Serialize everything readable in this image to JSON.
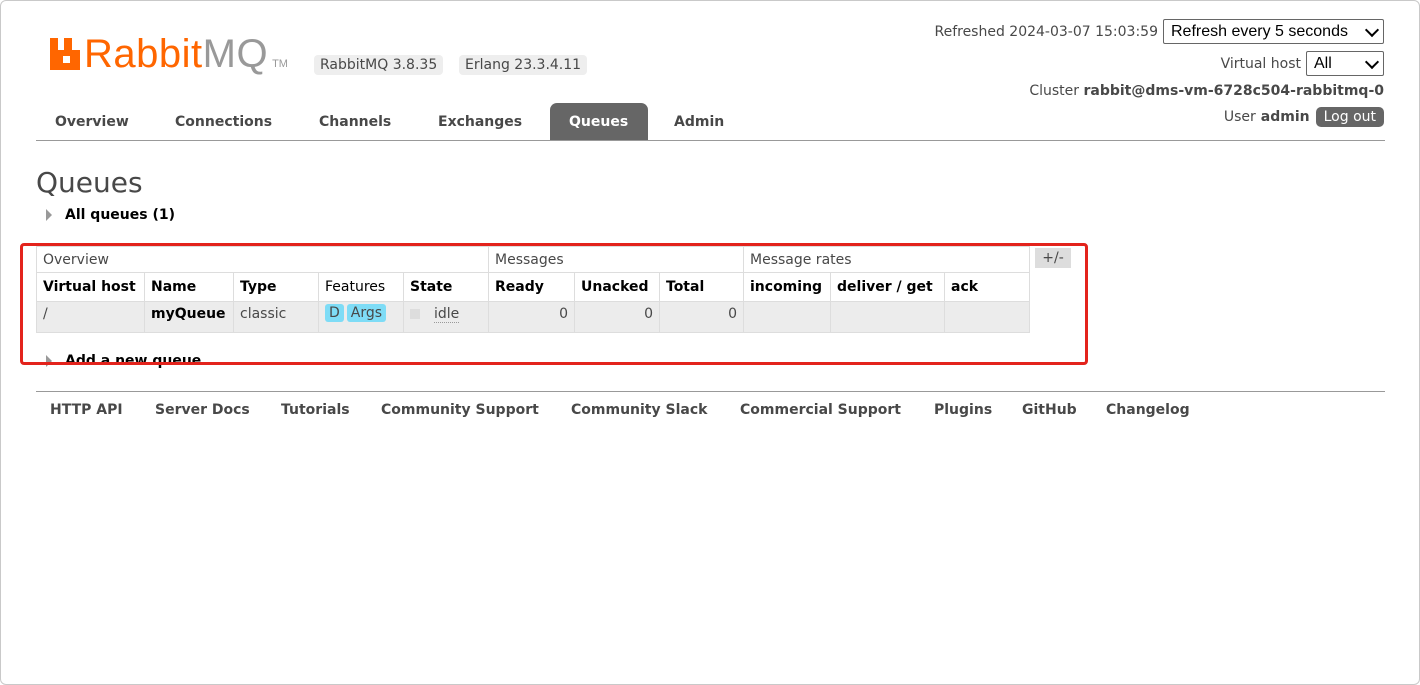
{
  "header": {
    "logo_rabbit": "Rabbit",
    "logo_mq": "MQ",
    "logo_tm": "TM",
    "rabbitmq_version": "RabbitMQ 3.8.35",
    "erlang_version": "Erlang 23.3.4.11",
    "refreshed_label": "Refreshed 2024-03-07 15:03:59",
    "refresh_select_value": "Refresh every 5 seconds",
    "vhost_label": "Virtual host",
    "vhost_select_value": "All",
    "cluster_label": "Cluster",
    "cluster_name": "rabbit@dms-vm-6728c504-rabbitmq-0",
    "user_label": "User",
    "user_name": "admin",
    "logout_label": "Log out"
  },
  "nav": {
    "tabs": [
      {
        "label": "Overview"
      },
      {
        "label": "Connections"
      },
      {
        "label": "Channels"
      },
      {
        "label": "Exchanges"
      },
      {
        "label": "Queues",
        "active": true
      },
      {
        "label": "Admin"
      }
    ]
  },
  "page": {
    "title": "Queues",
    "all_queues_toggle": "All queues (1)",
    "add_queue_toggle": "Add a new queue",
    "columns_toggle": "+/-"
  },
  "table": {
    "groups": [
      "Overview",
      "Messages",
      "Message rates"
    ],
    "columns": [
      "Virtual host",
      "Name",
      "Type",
      "Features",
      "State",
      "Ready",
      "Unacked",
      "Total",
      "incoming",
      "deliver / get",
      "ack"
    ],
    "rows": [
      {
        "vhost": "/",
        "name": "myQueue",
        "type": "classic",
        "features": [
          "D",
          "Args"
        ],
        "state": "idle",
        "ready": "0",
        "unacked": "0",
        "total": "0",
        "incoming": "",
        "deliver_get": "",
        "ack": ""
      }
    ]
  },
  "footer": {
    "links": [
      "HTTP API",
      "Server Docs",
      "Tutorials",
      "Community Support",
      "Community Slack",
      "Commercial Support",
      "Plugins",
      "GitHub",
      "Changelog"
    ]
  },
  "colors": {
    "brand_orange": "#ff6600",
    "highlight_red": "#e3231c",
    "feature_badge": "#7edcf6",
    "active_tab": "#666666"
  }
}
